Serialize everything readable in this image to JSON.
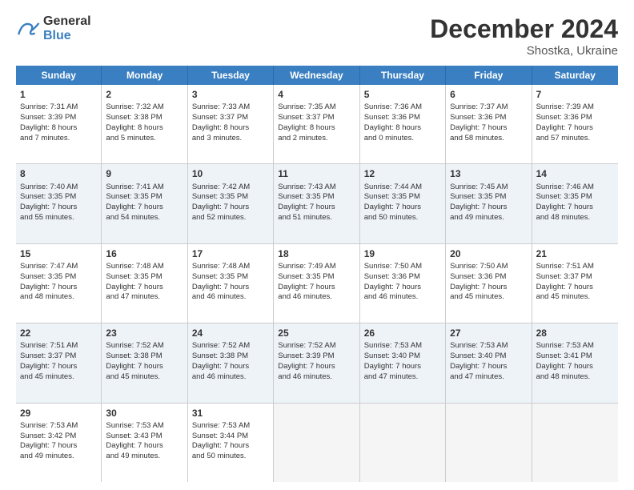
{
  "logo": {
    "line1": "General",
    "line2": "Blue"
  },
  "title": "December 2024",
  "subtitle": "Shostka, Ukraine",
  "days_of_week": [
    "Sunday",
    "Monday",
    "Tuesday",
    "Wednesday",
    "Thursday",
    "Friday",
    "Saturday"
  ],
  "weeks": [
    [
      {
        "day": "1",
        "lines": [
          "Sunrise: 7:31 AM",
          "Sunset: 3:39 PM",
          "Daylight: 8 hours",
          "and 7 minutes."
        ]
      },
      {
        "day": "2",
        "lines": [
          "Sunrise: 7:32 AM",
          "Sunset: 3:38 PM",
          "Daylight: 8 hours",
          "and 5 minutes."
        ]
      },
      {
        "day": "3",
        "lines": [
          "Sunrise: 7:33 AM",
          "Sunset: 3:37 PM",
          "Daylight: 8 hours",
          "and 3 minutes."
        ]
      },
      {
        "day": "4",
        "lines": [
          "Sunrise: 7:35 AM",
          "Sunset: 3:37 PM",
          "Daylight: 8 hours",
          "and 2 minutes."
        ]
      },
      {
        "day": "5",
        "lines": [
          "Sunrise: 7:36 AM",
          "Sunset: 3:36 PM",
          "Daylight: 8 hours",
          "and 0 minutes."
        ]
      },
      {
        "day": "6",
        "lines": [
          "Sunrise: 7:37 AM",
          "Sunset: 3:36 PM",
          "Daylight: 7 hours",
          "and 58 minutes."
        ]
      },
      {
        "day": "7",
        "lines": [
          "Sunrise: 7:39 AM",
          "Sunset: 3:36 PM",
          "Daylight: 7 hours",
          "and 57 minutes."
        ]
      }
    ],
    [
      {
        "day": "8",
        "lines": [
          "Sunrise: 7:40 AM",
          "Sunset: 3:35 PM",
          "Daylight: 7 hours",
          "and 55 minutes."
        ]
      },
      {
        "day": "9",
        "lines": [
          "Sunrise: 7:41 AM",
          "Sunset: 3:35 PM",
          "Daylight: 7 hours",
          "and 54 minutes."
        ]
      },
      {
        "day": "10",
        "lines": [
          "Sunrise: 7:42 AM",
          "Sunset: 3:35 PM",
          "Daylight: 7 hours",
          "and 52 minutes."
        ]
      },
      {
        "day": "11",
        "lines": [
          "Sunrise: 7:43 AM",
          "Sunset: 3:35 PM",
          "Daylight: 7 hours",
          "and 51 minutes."
        ]
      },
      {
        "day": "12",
        "lines": [
          "Sunrise: 7:44 AM",
          "Sunset: 3:35 PM",
          "Daylight: 7 hours",
          "and 50 minutes."
        ]
      },
      {
        "day": "13",
        "lines": [
          "Sunrise: 7:45 AM",
          "Sunset: 3:35 PM",
          "Daylight: 7 hours",
          "and 49 minutes."
        ]
      },
      {
        "day": "14",
        "lines": [
          "Sunrise: 7:46 AM",
          "Sunset: 3:35 PM",
          "Daylight: 7 hours",
          "and 48 minutes."
        ]
      }
    ],
    [
      {
        "day": "15",
        "lines": [
          "Sunrise: 7:47 AM",
          "Sunset: 3:35 PM",
          "Daylight: 7 hours",
          "and 48 minutes."
        ]
      },
      {
        "day": "16",
        "lines": [
          "Sunrise: 7:48 AM",
          "Sunset: 3:35 PM",
          "Daylight: 7 hours",
          "and 47 minutes."
        ]
      },
      {
        "day": "17",
        "lines": [
          "Sunrise: 7:48 AM",
          "Sunset: 3:35 PM",
          "Daylight: 7 hours",
          "and 46 minutes."
        ]
      },
      {
        "day": "18",
        "lines": [
          "Sunrise: 7:49 AM",
          "Sunset: 3:35 PM",
          "Daylight: 7 hours",
          "and 46 minutes."
        ]
      },
      {
        "day": "19",
        "lines": [
          "Sunrise: 7:50 AM",
          "Sunset: 3:36 PM",
          "Daylight: 7 hours",
          "and 46 minutes."
        ]
      },
      {
        "day": "20",
        "lines": [
          "Sunrise: 7:50 AM",
          "Sunset: 3:36 PM",
          "Daylight: 7 hours",
          "and 45 minutes."
        ]
      },
      {
        "day": "21",
        "lines": [
          "Sunrise: 7:51 AM",
          "Sunset: 3:37 PM",
          "Daylight: 7 hours",
          "and 45 minutes."
        ]
      }
    ],
    [
      {
        "day": "22",
        "lines": [
          "Sunrise: 7:51 AM",
          "Sunset: 3:37 PM",
          "Daylight: 7 hours",
          "and 45 minutes."
        ]
      },
      {
        "day": "23",
        "lines": [
          "Sunrise: 7:52 AM",
          "Sunset: 3:38 PM",
          "Daylight: 7 hours",
          "and 45 minutes."
        ]
      },
      {
        "day": "24",
        "lines": [
          "Sunrise: 7:52 AM",
          "Sunset: 3:38 PM",
          "Daylight: 7 hours",
          "and 46 minutes."
        ]
      },
      {
        "day": "25",
        "lines": [
          "Sunrise: 7:52 AM",
          "Sunset: 3:39 PM",
          "Daylight: 7 hours",
          "and 46 minutes."
        ]
      },
      {
        "day": "26",
        "lines": [
          "Sunrise: 7:53 AM",
          "Sunset: 3:40 PM",
          "Daylight: 7 hours",
          "and 47 minutes."
        ]
      },
      {
        "day": "27",
        "lines": [
          "Sunrise: 7:53 AM",
          "Sunset: 3:40 PM",
          "Daylight: 7 hours",
          "and 47 minutes."
        ]
      },
      {
        "day": "28",
        "lines": [
          "Sunrise: 7:53 AM",
          "Sunset: 3:41 PM",
          "Daylight: 7 hours",
          "and 48 minutes."
        ]
      }
    ],
    [
      {
        "day": "29",
        "lines": [
          "Sunrise: 7:53 AM",
          "Sunset: 3:42 PM",
          "Daylight: 7 hours",
          "and 49 minutes."
        ]
      },
      {
        "day": "30",
        "lines": [
          "Sunrise: 7:53 AM",
          "Sunset: 3:43 PM",
          "Daylight: 7 hours",
          "and 49 minutes."
        ]
      },
      {
        "day": "31",
        "lines": [
          "Sunrise: 7:53 AM",
          "Sunset: 3:44 PM",
          "Daylight: 7 hours",
          "and 50 minutes."
        ]
      },
      {
        "day": "",
        "lines": []
      },
      {
        "day": "",
        "lines": []
      },
      {
        "day": "",
        "lines": []
      },
      {
        "day": "",
        "lines": []
      }
    ]
  ]
}
